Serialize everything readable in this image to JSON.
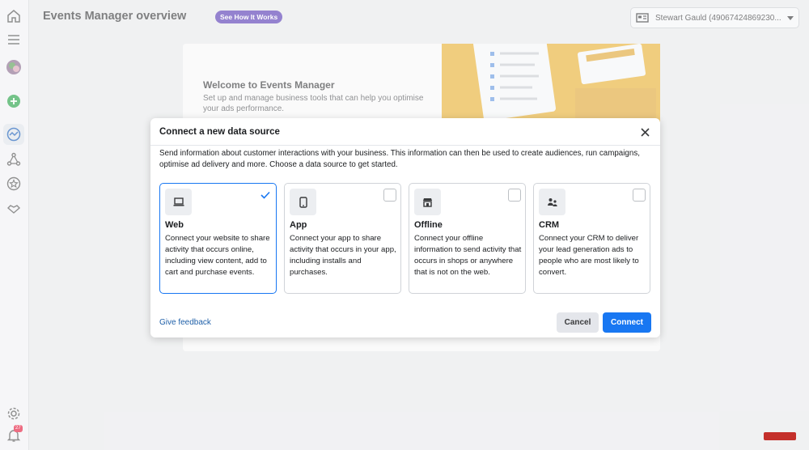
{
  "header": {
    "title": "Events Manager overview",
    "how_badge": "See How It Works",
    "account_name": "Stewart Gauld (49067424869230..."
  },
  "rail": {
    "notification_count": "27"
  },
  "welcome": {
    "title": "Welcome to Events Manager",
    "subtitle": "Set up and manage business tools that can help you optimise your ads performance."
  },
  "modal": {
    "title": "Connect a new data source",
    "description": "Send information about customer interactions with your business. This information can then be used to create audiences, run campaigns, optimise ad delivery and more. Choose a data source to get started.",
    "cards": [
      {
        "title": "Web",
        "description": "Connect your website to share activity that occurs online, including view content, add to cart and purchase events.",
        "icon": "laptop-icon",
        "selected": true
      },
      {
        "title": "App",
        "description": "Connect your app to share activity that occurs in your app, including installs and purchases.",
        "icon": "phone-icon",
        "selected": false
      },
      {
        "title": "Offline",
        "description": "Connect your offline information to send activity that occurs in shops or anywhere that is not on the web.",
        "icon": "store-icon",
        "selected": false
      },
      {
        "title": "CRM",
        "description": "Connect your CRM to deliver your lead generation ads to people who are most likely to convert.",
        "icon": "people-icon",
        "selected": false
      }
    ],
    "feedback_label": "Give feedback",
    "cancel_label": "Cancel",
    "connect_label": "Connect"
  },
  "colors": {
    "accent": "#1877f2",
    "badge": "#5b3fb5",
    "illustration": "#e8b33a"
  }
}
